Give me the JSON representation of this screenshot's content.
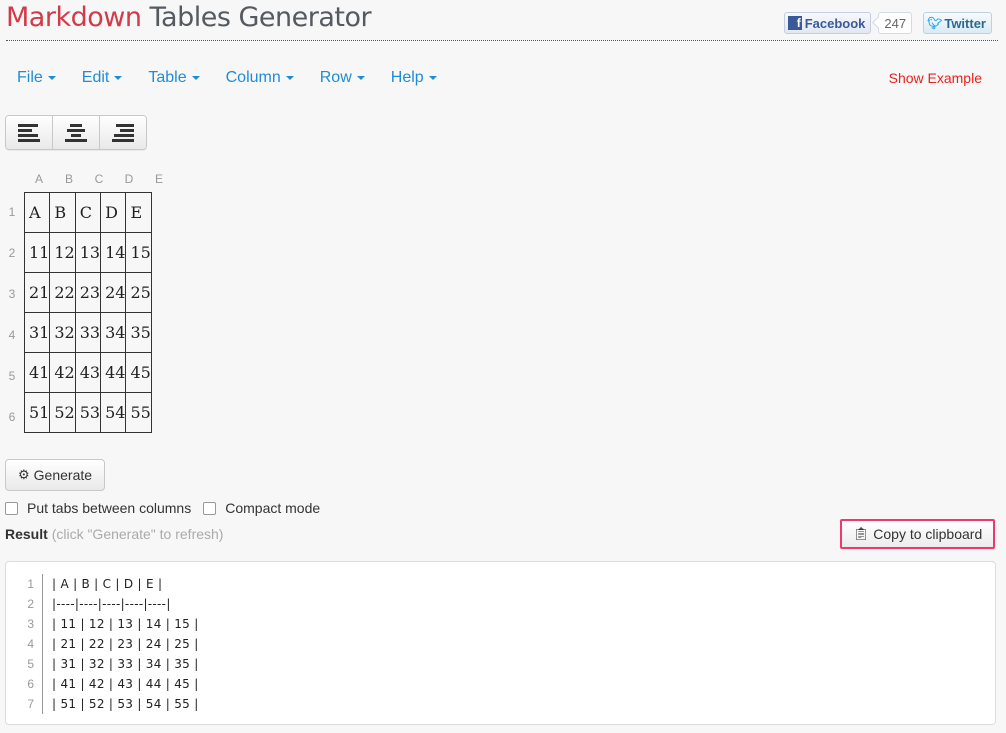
{
  "header": {
    "title_part1": "Markdown",
    "title_part2": "Tables Generator",
    "facebook_label": "Facebook",
    "facebook_count": "247",
    "twitter_label": "Twitter"
  },
  "menu": {
    "items": [
      {
        "label": "File"
      },
      {
        "label": "Edit"
      },
      {
        "label": "Table"
      },
      {
        "label": "Column"
      },
      {
        "label": "Row"
      },
      {
        "label": "Help"
      }
    ],
    "show_example": "Show Example"
  },
  "align_buttons": [
    "align-left",
    "align-center",
    "align-right"
  ],
  "grid": {
    "column_headers": [
      "A",
      "B",
      "C",
      "D",
      "E"
    ],
    "row_headers": [
      "1",
      "2",
      "3",
      "4",
      "5",
      "6"
    ],
    "rows": [
      [
        "A",
        "B",
        "C",
        "D",
        "E"
      ],
      [
        "11",
        "12",
        "13",
        "14",
        "15"
      ],
      [
        "21",
        "22",
        "23",
        "24",
        "25"
      ],
      [
        "31",
        "32",
        "33",
        "34",
        "35"
      ],
      [
        "41",
        "42",
        "43",
        "44",
        "45"
      ],
      [
        "51",
        "52",
        "53",
        "54",
        "55"
      ]
    ]
  },
  "generate_label": "Generate",
  "options": {
    "tabs_label": "Put tabs between columns",
    "compact_label": "Compact mode"
  },
  "result": {
    "label": "Result",
    "hint": "(click \"Generate\" to refresh)",
    "copy_label": "Copy to clipboard",
    "line_numbers": [
      "1",
      "2",
      "3",
      "4",
      "5",
      "6",
      "7"
    ],
    "lines": [
      "| A | B | C | D | E |",
      "|----|----|----|----|----|",
      "| 11 | 12 | 13 | 14 | 15 |",
      "| 21 | 22 | 23 | 24 | 25 |",
      "| 31 | 32 | 33 | 34 | 35 |",
      "| 41 | 42 | 43 | 44 | 45 |",
      "| 51 | 52 | 53 | 54 | 55 |"
    ]
  },
  "colors": {
    "brand_red": "#d33a48",
    "link_blue": "#1f8dd6",
    "show_example_red": "#e8231e",
    "highlight_pink": "#f0386b"
  }
}
